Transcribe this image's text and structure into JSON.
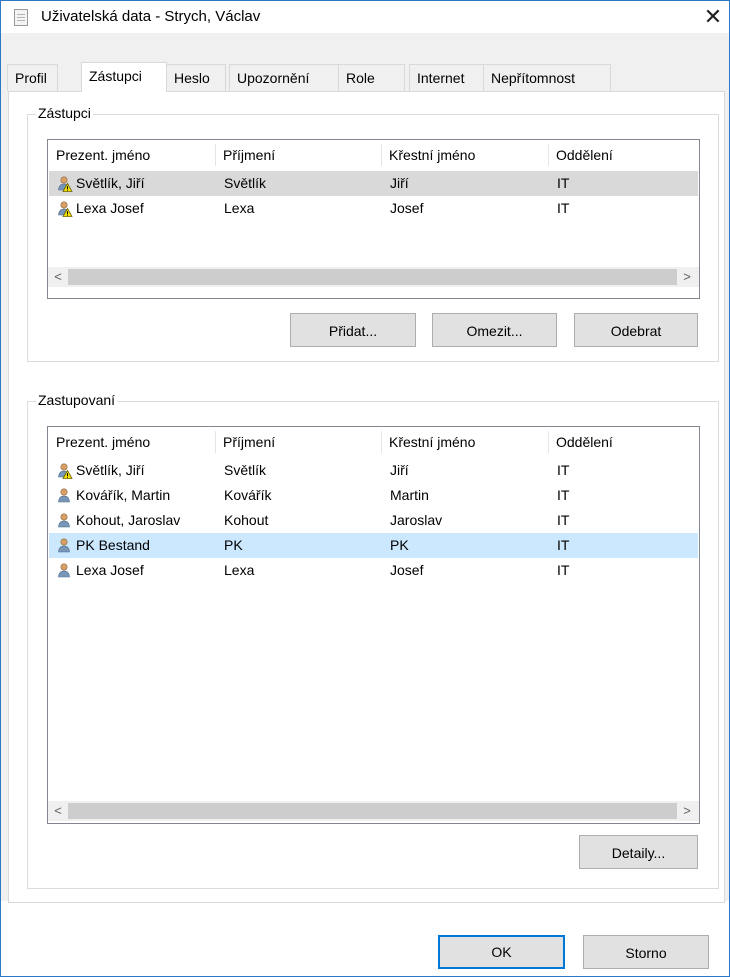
{
  "window": {
    "title": "Uživatelská data - Strych, Václav",
    "close_glyph": "✕"
  },
  "tabs": [
    "Profil",
    "Zástupci",
    "Heslo",
    "Upozornění",
    "Role",
    "Internet",
    "Nepřítomnost"
  ],
  "active_tab": "Zástupci",
  "columns": [
    "Prezent. jméno",
    "Příjmení",
    "Křestní jméno",
    "Oddělení"
  ],
  "zastupci": {
    "legend": "Zástupci",
    "rows": [
      {
        "display": "Světlík, Jiří",
        "surname": "Světlík",
        "first": "Jiří",
        "dept": "IT",
        "selected": true,
        "icon": "user-warning-icon"
      },
      {
        "display": "Lexa Josef",
        "surname": "Lexa",
        "first": "Josef",
        "dept": "IT",
        "selected": false,
        "icon": "user-warning-icon"
      }
    ],
    "buttons": {
      "add": "Přidat...",
      "restrict": "Omezit...",
      "remove": "Odebrat"
    }
  },
  "zastupovani": {
    "legend": "Zastupovaní",
    "rows": [
      {
        "display": "Světlík, Jiří",
        "surname": "Světlík",
        "first": "Jiří",
        "dept": "IT",
        "selected": false,
        "icon": "user-warning-icon"
      },
      {
        "display": "Kovářík, Martin",
        "surname": "Kovářík",
        "first": "Martin",
        "dept": "IT",
        "selected": false,
        "icon": "user-icon"
      },
      {
        "display": "Kohout, Jaroslav",
        "surname": "Kohout",
        "first": "Jaroslav",
        "dept": "IT",
        "selected": false,
        "icon": "user-icon"
      },
      {
        "display": "PK Bestand",
        "surname": "PK",
        "first": "PK",
        "dept": "IT",
        "selected": true,
        "icon": "user-icon"
      },
      {
        "display": "Lexa Josef",
        "surname": "Lexa",
        "first": "Josef",
        "dept": "IT",
        "selected": false,
        "icon": "user-icon"
      }
    ],
    "buttons": {
      "details": "Detaily..."
    }
  },
  "footer": {
    "ok": "OK",
    "cancel": "Storno"
  },
  "scroll": {
    "left": "<",
    "right": ">"
  },
  "colors": {
    "selection_gray": "#d9d9d9",
    "selection_blue": "#cce8ff",
    "accent": "#0078d7"
  }
}
